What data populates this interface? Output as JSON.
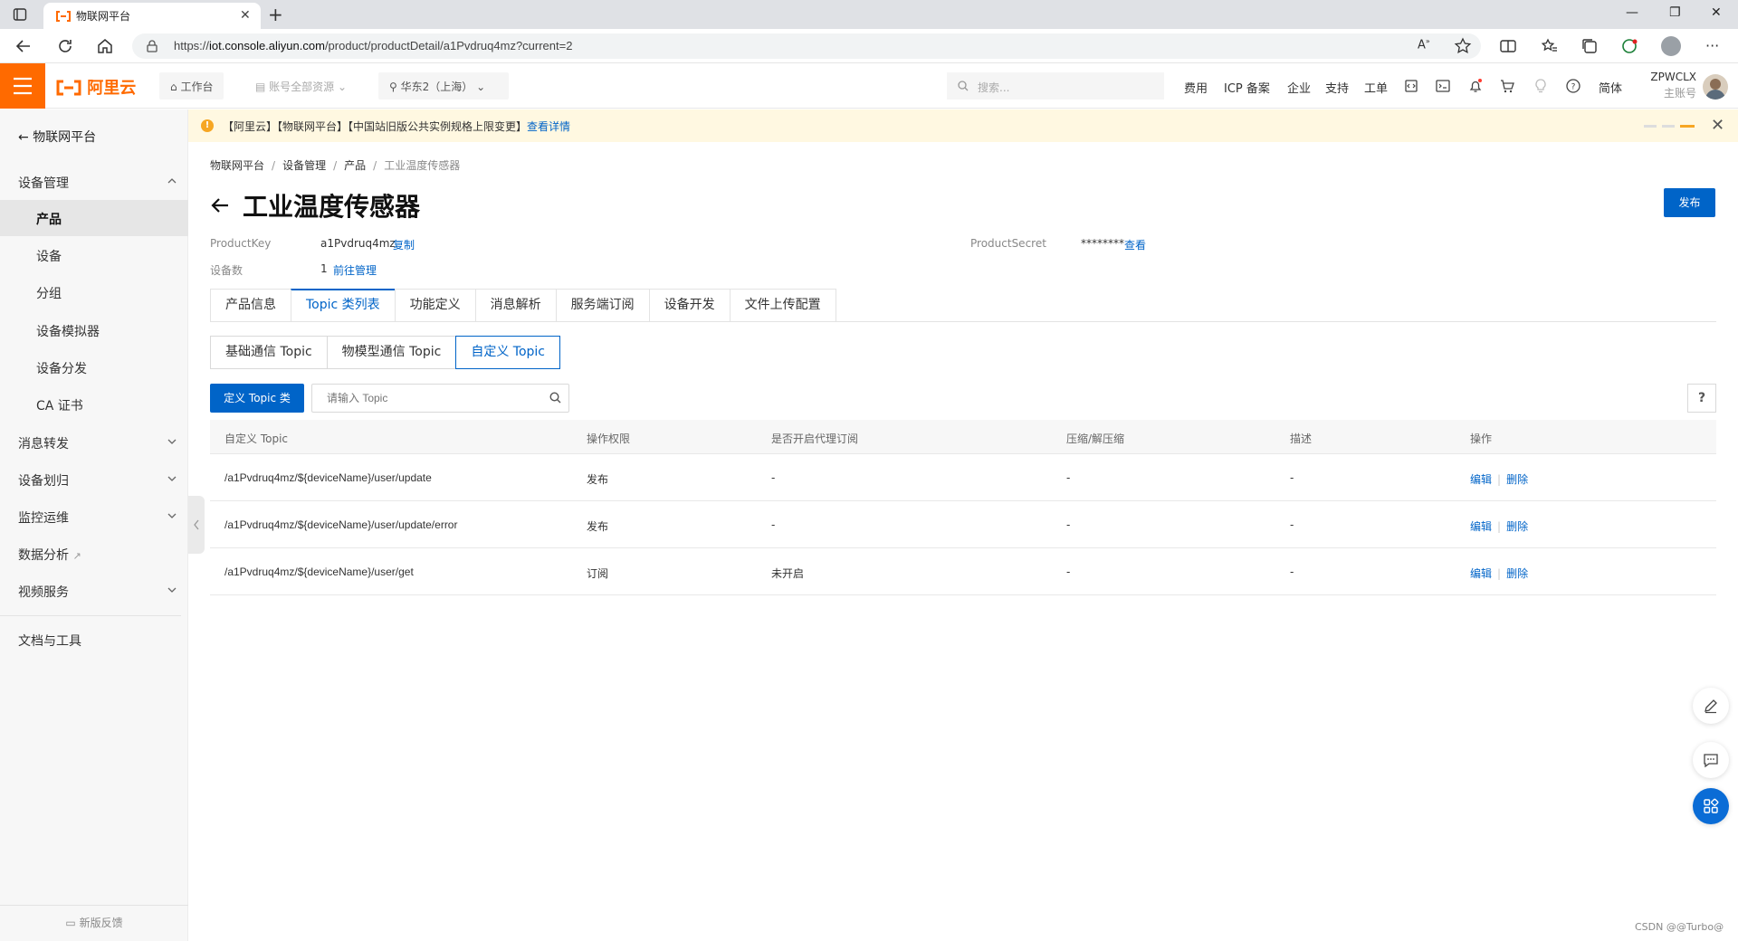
{
  "browser": {
    "tab_title": "物联网平台",
    "url_prefix": "https://",
    "url_host": "iot.console.aliyun.com",
    "url_path": "/product/productDetail/a1Pvdruq4mz?current=2"
  },
  "header": {
    "logo": "阿里云",
    "workbench": "工作台",
    "resources": "账号全部资源",
    "region": "华东2（上海）",
    "search_placeholder": "搜索...",
    "links": [
      "费用",
      "ICP 备案",
      "企业",
      "支持",
      "工单"
    ],
    "lang": "简体",
    "username": "ZPWCLX",
    "account_type": "主账号"
  },
  "sidebar": {
    "back_label": "物联网平台",
    "group_device": "设备管理",
    "items": [
      "产品",
      "设备",
      "分组",
      "设备模拟器",
      "设备分发",
      "CA 证书"
    ],
    "groups": [
      "消息转发",
      "设备划归",
      "监控运维",
      "数据分析",
      "视频服务"
    ],
    "docs": "文档与工具",
    "feedback": "新版反馈"
  },
  "banner": {
    "text": "【阿里云】【物联网平台】【中国站旧版公共实例规格上限变更】",
    "link": "查看详情"
  },
  "breadcrumb": [
    "物联网平台",
    "设备管理",
    "产品",
    "工业温度传感器"
  ],
  "page": {
    "title": "工业温度传感器",
    "publish": "发布",
    "product_key_label": "ProductKey",
    "product_key": "a1Pvdruq4mz",
    "copy": "复制",
    "device_count_label": "设备数",
    "device_count": "1",
    "manage_link": "前往管理",
    "product_secret_label": "ProductSecret",
    "product_secret": "********",
    "view": "查看"
  },
  "tabs": [
    "产品信息",
    "Topic 类列表",
    "功能定义",
    "消息解析",
    "服务端订阅",
    "设备开发",
    "文件上传配置"
  ],
  "subtabs": [
    "基础通信 Topic",
    "物模型通信 Topic",
    "自定义 Topic"
  ],
  "toolbar": {
    "define_button": "定义 Topic 类",
    "search_placeholder": "请输入 Topic",
    "help": "?"
  },
  "table": {
    "columns": [
      "自定义 Topic",
      "操作权限",
      "是否开启代理订阅",
      "压缩/解压缩",
      "描述",
      "操作"
    ],
    "rows": [
      {
        "topic": "/a1Pvdruq4mz/${deviceName}/user/update",
        "perm": "发布",
        "proxy": "-",
        "compress": "-",
        "desc": "-"
      },
      {
        "topic": "/a1Pvdruq4mz/${deviceName}/user/update/error",
        "perm": "发布",
        "proxy": "-",
        "compress": "-",
        "desc": "-"
      },
      {
        "topic": "/a1Pvdruq4mz/${deviceName}/user/get",
        "perm": "订阅",
        "proxy": "未开启",
        "compress": "-",
        "desc": "-"
      }
    ],
    "edit": "编辑",
    "delete": "删除"
  },
  "watermark": "CSDN @@Turbo@",
  "colors": {
    "brand": "#ff6a00",
    "primary": "#0064c8",
    "banner_bg": "#fff8e1"
  }
}
